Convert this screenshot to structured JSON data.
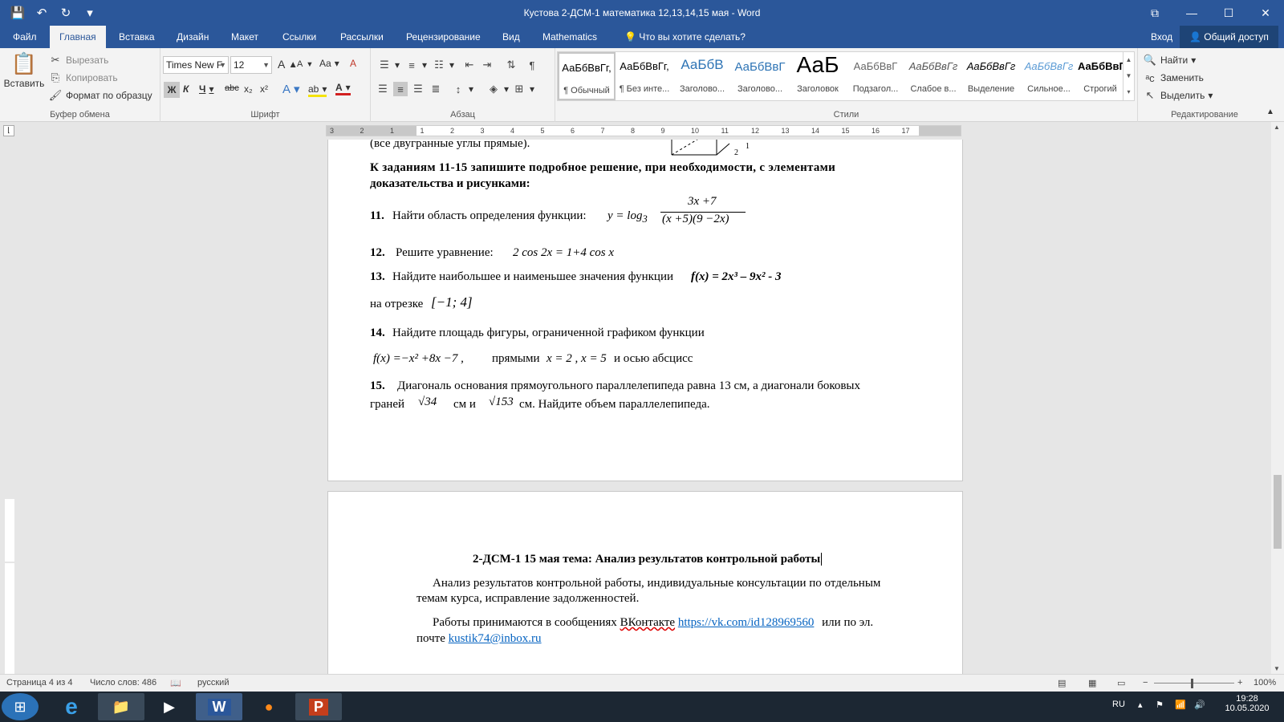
{
  "window": {
    "title": "Кустова 2-ДСМ-1 математика 12,13,14,15 мая  -  Word"
  },
  "qat": {
    "save": "💾",
    "undo": "↶",
    "redo": "↻",
    "more": "▾"
  },
  "winctrl": {
    "restore": "⧉",
    "minimize": "—",
    "maximize": "☐",
    "close": "✕"
  },
  "tabs": [
    "Файл",
    "Главная",
    "Вставка",
    "Дизайн",
    "Макет",
    "Ссылки",
    "Рассылки",
    "Рецензирование",
    "Вид",
    "Mathematics"
  ],
  "tell_me": "Что вы хотите сделать?",
  "signin": "Вход",
  "share": "Общий доступ",
  "clipboard": {
    "paste": "Вставить",
    "cut": "Вырезать",
    "copy": "Копировать",
    "format_painter": "Формат по образцу",
    "label": "Буфер обмена"
  },
  "font": {
    "name": "Times New F",
    "size": "12",
    "label": "Шрифт",
    "bold": "Ж",
    "italic": "К",
    "underline": "Ч",
    "strike": "abc",
    "sub": "x₂",
    "sup": "x²",
    "grow": "A",
    "shrink": "A",
    "case": "Aa",
    "clear": "A",
    "effects": "A",
    "highlight": "ab",
    "color": "A"
  },
  "paragraph": {
    "label": "Абзац"
  },
  "styles": {
    "label": "Стили",
    "items": [
      {
        "preview": "АаБбВвГг,",
        "name": "¶ Обычный"
      },
      {
        "preview": "АаБбВвГг,",
        "name": "¶ Без инте..."
      },
      {
        "preview": "АаБбВ",
        "name": "Заголово..."
      },
      {
        "preview": "АаБбВвГ",
        "name": "Заголово..."
      },
      {
        "preview": "АаБ",
        "name": "Заголовок"
      },
      {
        "preview": "АаБбВвГ",
        "name": "Подзагол..."
      },
      {
        "preview": "АаБбВвГг",
        "name": "Слабое в..."
      },
      {
        "preview": "АаБбВвГг",
        "name": "Выделение"
      },
      {
        "preview": "АаБбВвГг",
        "name": "Сильное..."
      },
      {
        "preview": "АаБбВвГг,",
        "name": "Строгий"
      }
    ]
  },
  "editing": {
    "find": "Найти",
    "replace": "Заменить",
    "select": "Выделить",
    "label": "Редактирование"
  },
  "ruler": {
    "ticks": [
      "3",
      "2",
      "1",
      "1",
      "2",
      "3",
      "4",
      "5",
      "6",
      "7",
      "8",
      "9",
      "10",
      "11",
      "12",
      "13",
      "14",
      "15",
      "16",
      "17"
    ]
  },
  "doc": {
    "line0": "(все двугранные углы прямые).",
    "intro": "К заданиям 11-15 запишите подробное решение, при необходимости, с элементами",
    "intro2": "доказательства и рисунками:",
    "t11_num": "11.",
    "t11_text": "Найти область определения функции:",
    "t11_y": "y  =  log",
    "t11_sub": "3",
    "t11_numr": "3x +7",
    "t11_den": "(x +5)(9 −2x)",
    "t12_num": "12.",
    "t12_text": "Решите уравнение:",
    "t12_eq": "2 cos 2x = 1+4 cos x",
    "t13_num": "13.",
    "t13_text": "Найдите наибольшее и наименьшее значения функции",
    "t13_f": "f(x) = 2x³ – 9x² - 3",
    "t13_seg": "на отрезке",
    "t13_int": "[−1; 4]",
    "t14_num": "14.",
    "t14_text": "Найдите площадь фигуры, ограниченной графиком функции",
    "t14_f": "f(x) =−x² +8x −7 ,",
    "t14_mid": "прямыми",
    "t14_x1": "x = 2 ,  x = 5",
    "t14_end": "и осью абсцисс",
    "t15_num": "15.",
    "t15_text": "Диагональ основания прямоугольного параллелепипеда равна 13 см, а диагонали боковых",
    "t15_a": "граней",
    "t15_r1": "√34",
    "t15_b": "см  и",
    "t15_r2": "√153",
    "t15_c": "см. Найдите объем параллелепипеда.",
    "p2_title": "2-ДСМ-1   15 мая   тема: Анализ результатов контрольной работы",
    "p2_para1a": "Анализ результатов контрольной работы, индивидуальные консультации по отдельным",
    "p2_para1b": "темам курса, исправление задолженностей.",
    "p2_para2a": "Работы принимаются в сообщениях",
    "p2_vk": "ВКонтакте",
    "p2_link": "https://vk.com/id128969560",
    "p2_para2b": "или по эл.",
    "p2_para3": "почте",
    "p2_mail": "kustik74@inbox.ru"
  },
  "status": {
    "page": "Страница 4 из 4",
    "words": "Число слов: 486",
    "lang": "русский",
    "zoom": "100%"
  },
  "tray": {
    "lang": "RU",
    "time": "19:28",
    "date": "10.05.2020"
  }
}
